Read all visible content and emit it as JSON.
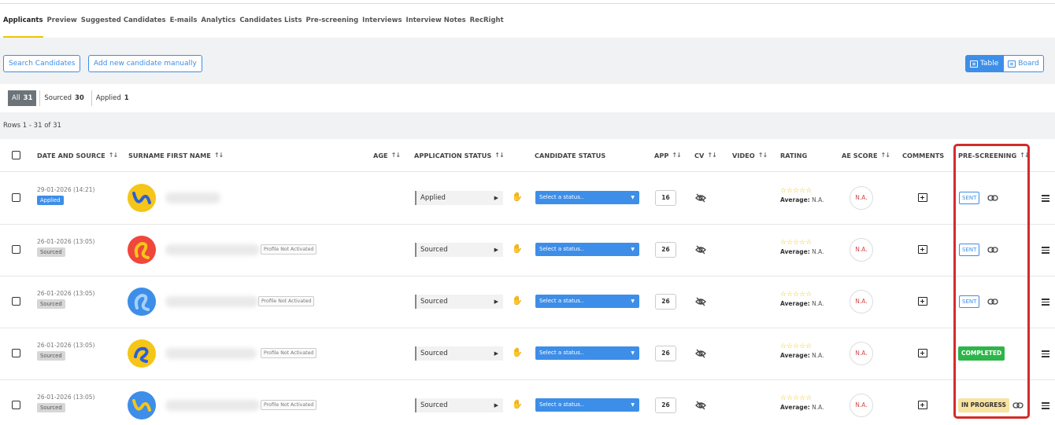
{
  "tabs": [
    "Applicants",
    "Preview",
    "Suggested Candidates",
    "E-mails",
    "Analytics",
    "Candidates Lists",
    "Pre-screening",
    "Interviews",
    "Interview Notes",
    "RecRight"
  ],
  "toolbar": {
    "search_label": "Search Candidates",
    "add_label": "Add new candidate manually",
    "table_label": "Table",
    "board_label": "Board"
  },
  "filters": [
    {
      "label": "All",
      "count": "31"
    },
    {
      "label": "Sourced",
      "count": "30"
    },
    {
      "label": "Applied",
      "count": "1"
    }
  ],
  "rows_count": "Rows 1 - 31 of 31",
  "headers": {
    "date": "DATE AND SOURCE",
    "name": "SURNAME FIRST NAME",
    "age": "AGE",
    "app_status": "APPLICATION STATUS",
    "cand_status": "CANDIDATE STATUS",
    "app": "APP",
    "cv": "CV",
    "video": "VIDEO",
    "rating": "RATING",
    "ae": "AE SCORE",
    "comments": "COMMENTS",
    "pre": "PRE-SCREENING"
  },
  "rows": [
    {
      "date": "29-01-2026 (14:21)",
      "source": "Applied",
      "profile": "",
      "app_status": "Applied",
      "cand_status": "Select a status..",
      "app": "16",
      "avg_label": "Average:",
      "avg_value": "N.A.",
      "ae": "N.A.",
      "pre": "SENT"
    },
    {
      "date": "26-01-2026 (13:05)",
      "source": "Sourced",
      "profile": "Profile Not Activated",
      "app_status": "Sourced",
      "cand_status": "Select a status..",
      "app": "26",
      "avg_label": "Average:",
      "avg_value": "N.A.",
      "ae": "N.A.",
      "pre": "SENT"
    },
    {
      "date": "26-01-2026 (13:05)",
      "source": "Sourced",
      "profile": "Profile Not Activated",
      "app_status": "Sourced",
      "cand_status": "Select a status..",
      "app": "26",
      "avg_label": "Average:",
      "avg_value": "N.A.",
      "ae": "N.A.",
      "pre": "SENT"
    },
    {
      "date": "26-01-2026 (13:05)",
      "source": "Sourced",
      "profile": "Profile Not Activated",
      "app_status": "Sourced",
      "cand_status": "Select a status..",
      "app": "26",
      "avg_label": "Average:",
      "avg_value": "N.A.",
      "ae": "N.A.",
      "pre": "COMPLETED"
    },
    {
      "date": "26-01-2026 (13:05)",
      "source": "Sourced",
      "profile": "Profile Not Activated",
      "app_status": "Sourced",
      "cand_status": "Select a status..",
      "app": "26",
      "avg_label": "Average:",
      "avg_value": "N.A.",
      "ae": "N.A.",
      "pre": "IN PROGRESS"
    }
  ],
  "colors": {
    "accent": "#3d8ee8",
    "completed": "#2db54a",
    "in_progress": "#f8e3a0",
    "highlight": "#d42b2b",
    "tab_underline": "#f0c400"
  },
  "avatar_styles": [
    {
      "bg": "#f5c518",
      "stroke": "#2b5fd9",
      "icon": "wave-logo-icon"
    },
    {
      "bg": "#f0473c",
      "stroke": "#f5c518",
      "icon": "loop-logo-icon"
    },
    {
      "bg": "#3d8ee8",
      "stroke": "#a6d0ff",
      "icon": "loop-logo-icon"
    },
    {
      "bg": "#f5c518",
      "stroke": "#2b5fd9",
      "icon": "swirl-logo-icon"
    },
    {
      "bg": "#3d8ee8",
      "stroke": "#f5c518",
      "icon": "wave-logo-icon"
    }
  ]
}
